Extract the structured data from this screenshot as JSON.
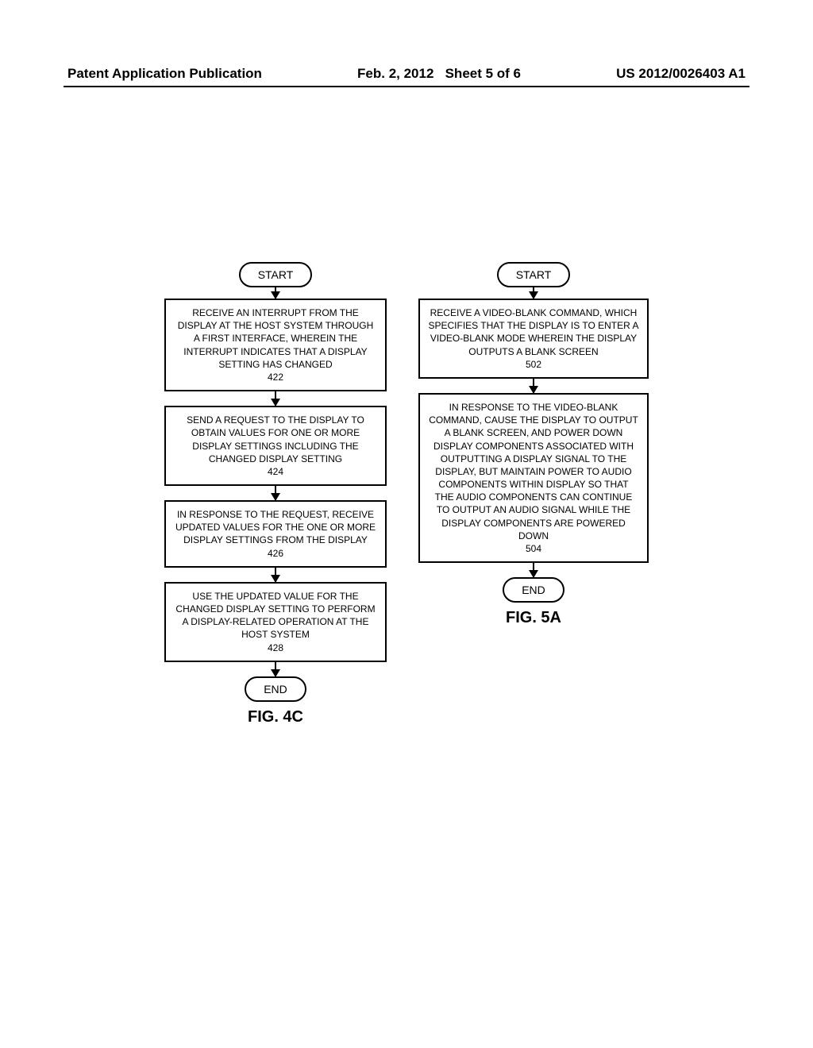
{
  "header": {
    "left": "Patent Application Publication",
    "center_date": "Feb. 2, 2012",
    "center_sheet": "Sheet 5 of 6",
    "right": "US 2012/0026403 A1"
  },
  "flowchart_left": {
    "start": "START",
    "box1": "RECEIVE AN INTERRUPT FROM THE DISPLAY AT THE HOST SYSTEM THROUGH A FIRST INTERFACE, WHEREIN THE INTERRUPT INDICATES THAT A  DISPLAY SETTING HAS CHANGED",
    "box1_num": "422",
    "box2": "SEND A REQUEST TO THE DISPLAY TO OBTAIN VALUES FOR ONE OR MORE DISPLAY SETTINGS INCLUDING THE CHANGED DISPLAY SETTING",
    "box2_num": "424",
    "box3": "IN RESPONSE TO THE REQUEST, RECEIVE UPDATED VALUES FOR THE ONE OR MORE DISPLAY SETTINGS FROM THE DISPLAY",
    "box3_num": "426",
    "box4": "USE THE UPDATED VALUE FOR THE CHANGED DISPLAY SETTING TO PERFORM A DISPLAY-RELATED OPERATION AT THE HOST SYSTEM",
    "box4_num": "428",
    "end": "END",
    "fig": "FIG. 4C"
  },
  "flowchart_right": {
    "start": "START",
    "box1": "RECEIVE A VIDEO-BLANK COMMAND, WHICH SPECIFIES THAT THE DISPLAY IS TO ENTER A VIDEO-BLANK MODE WHEREIN THE DISPLAY OUTPUTS A BLANK SCREEN",
    "box1_num": "502",
    "box2": "IN RESPONSE TO THE VIDEO-BLANK COMMAND, CAUSE THE DISPLAY TO OUTPUT A BLANK SCREEN, AND POWER DOWN DISPLAY COMPONENTS ASSOCIATED WITH OUTPUTTING A DISPLAY SIGNAL TO THE DISPLAY, BUT MAINTAIN POWER TO AUDIO COMPONENTS WITHIN DISPLAY SO THAT THE AUDIO COMPONENTS CAN CONTINUE TO OUTPUT AN AUDIO SIGNAL WHILE THE DISPLAY COMPONENTS ARE POWERED DOWN",
    "box2_num": "504",
    "end": "END",
    "fig": "FIG. 5A"
  }
}
